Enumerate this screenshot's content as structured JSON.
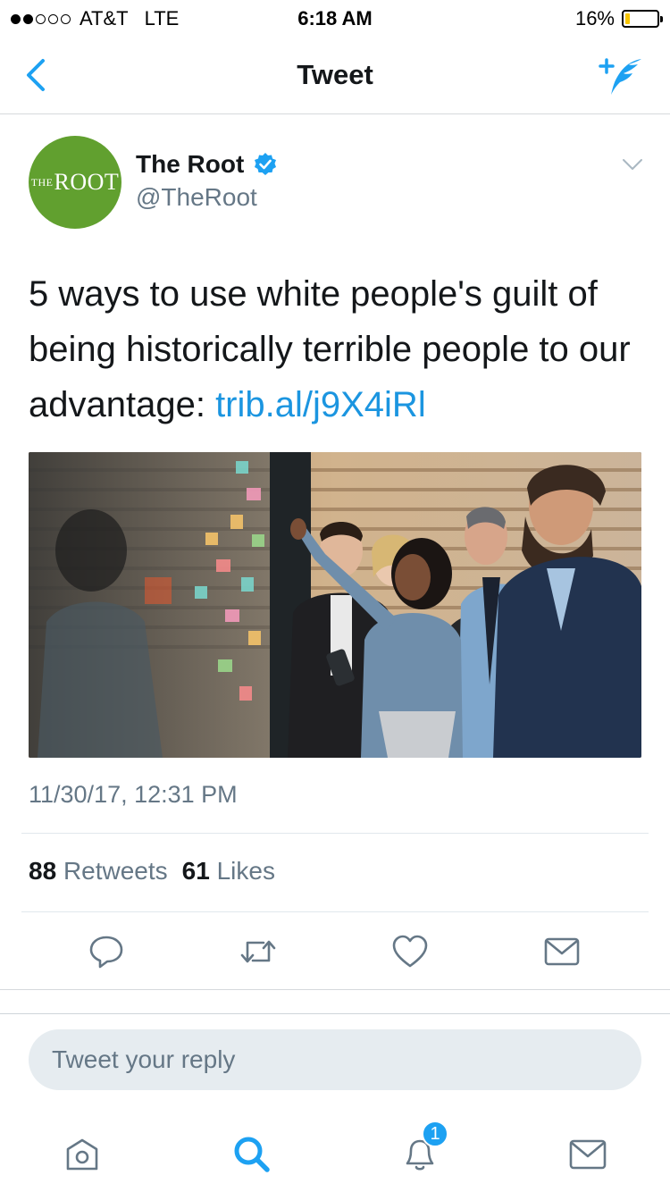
{
  "status_bar": {
    "carrier": "AT&T",
    "network": "LTE",
    "time": "6:18 AM",
    "battery_percent": "16%",
    "battery_level": 0.16,
    "signal_bars_filled": 2,
    "signal_bars_total": 5
  },
  "nav": {
    "title": "Tweet",
    "back_icon": "chevron-left-icon",
    "compose_icon": "compose-tweet-icon"
  },
  "tweet": {
    "author_name": "The Root",
    "author_handle": "@TheRoot",
    "avatar_text_small": "THE",
    "avatar_text_big": "ROOT",
    "avatar_color": "#61a02f",
    "verified": true,
    "text": "5 ways to use white people's guilt of being historically terrible people to our advantage: ",
    "link": "trib.al/j9X4iRl",
    "timestamp": "11/30/17, 12:31 PM",
    "retweets_count": "88",
    "retweets_label": "Retweets",
    "likes_count": "61",
    "likes_label": "Likes"
  },
  "actions": [
    "reply-icon",
    "retweet-icon",
    "like-icon",
    "share-icon"
  ],
  "reply": {
    "placeholder": "Tweet your reply"
  },
  "tab_bar": {
    "items": [
      "home-icon",
      "search-icon",
      "notifications-icon",
      "messages-icon"
    ],
    "notifications_badge": "1"
  },
  "colors": {
    "accent": "#1da1f2",
    "link": "#1b95e0",
    "muted": "#657786"
  }
}
